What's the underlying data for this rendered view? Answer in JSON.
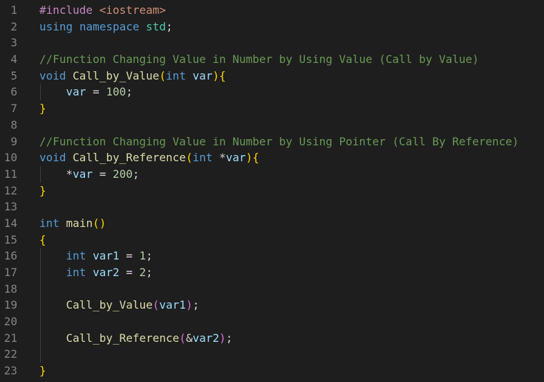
{
  "editor": {
    "theme_colors": {
      "background": "#1e1e1e",
      "line_number": "#858585",
      "preprocessor": "#c586c0",
      "string": "#ce9178",
      "keyword": "#569cd6",
      "namespace": "#4ec9b0",
      "comment": "#6a9955",
      "function": "#dcdcaa",
      "variable": "#9cdcfe",
      "number": "#b5cea8",
      "bracket_level_1": "#ffd700",
      "bracket_level_2": "#da70d6"
    },
    "lines": [
      {
        "n": "1",
        "tokens": [
          {
            "t": "#include ",
            "c": "pp"
          },
          {
            "t": "<iostream>",
            "c": "str"
          }
        ]
      },
      {
        "n": "2",
        "tokens": [
          {
            "t": "using",
            "c": "kw"
          },
          {
            "t": " ",
            "c": "op"
          },
          {
            "t": "namespace",
            "c": "kw"
          },
          {
            "t": " ",
            "c": "op"
          },
          {
            "t": "std",
            "c": "ns"
          },
          {
            "t": ";",
            "c": "op"
          }
        ]
      },
      {
        "n": "3",
        "tokens": []
      },
      {
        "n": "4",
        "tokens": [
          {
            "t": "//Function Changing Value in Number by Using Value (Call by Value)",
            "c": "cm"
          }
        ]
      },
      {
        "n": "5",
        "tokens": [
          {
            "t": "void",
            "c": "kw"
          },
          {
            "t": " ",
            "c": "op"
          },
          {
            "t": "Call_by_Value",
            "c": "fn"
          },
          {
            "t": "(",
            "c": "b1"
          },
          {
            "t": "int",
            "c": "kw"
          },
          {
            "t": " ",
            "c": "op"
          },
          {
            "t": "var",
            "c": "var"
          },
          {
            "t": ")",
            "c": "b1"
          },
          {
            "t": "{",
            "c": "b1"
          }
        ]
      },
      {
        "n": "6",
        "tokens": [
          {
            "t": "    ",
            "c": "op"
          },
          {
            "t": "var",
            "c": "var"
          },
          {
            "t": " = ",
            "c": "op"
          },
          {
            "t": "100",
            "c": "num"
          },
          {
            "t": ";",
            "c": "op"
          }
        ]
      },
      {
        "n": "7",
        "tokens": [
          {
            "t": "}",
            "c": "b1"
          }
        ]
      },
      {
        "n": "8",
        "tokens": []
      },
      {
        "n": "9",
        "tokens": [
          {
            "t": "//Function Changing Value in Number by Using Pointer (Call By Reference)",
            "c": "cm"
          }
        ]
      },
      {
        "n": "10",
        "tokens": [
          {
            "t": "void",
            "c": "kw"
          },
          {
            "t": " ",
            "c": "op"
          },
          {
            "t": "Call_by_Reference",
            "c": "fn"
          },
          {
            "t": "(",
            "c": "b1"
          },
          {
            "t": "int",
            "c": "kw"
          },
          {
            "t": " *",
            "c": "op"
          },
          {
            "t": "var",
            "c": "var"
          },
          {
            "t": ")",
            "c": "b1"
          },
          {
            "t": "{",
            "c": "b1"
          }
        ]
      },
      {
        "n": "11",
        "tokens": [
          {
            "t": "    *",
            "c": "op"
          },
          {
            "t": "var",
            "c": "var"
          },
          {
            "t": " = ",
            "c": "op"
          },
          {
            "t": "200",
            "c": "num"
          },
          {
            "t": ";",
            "c": "op"
          }
        ]
      },
      {
        "n": "12",
        "tokens": [
          {
            "t": "}",
            "c": "b1"
          }
        ]
      },
      {
        "n": "13",
        "tokens": []
      },
      {
        "n": "14",
        "tokens": [
          {
            "t": "int",
            "c": "kw"
          },
          {
            "t": " ",
            "c": "op"
          },
          {
            "t": "main",
            "c": "fn"
          },
          {
            "t": "()",
            "c": "b1"
          }
        ]
      },
      {
        "n": "15",
        "tokens": [
          {
            "t": "{",
            "c": "b1"
          }
        ]
      },
      {
        "n": "16",
        "tokens": [
          {
            "t": "    ",
            "c": "op"
          },
          {
            "t": "int",
            "c": "kw"
          },
          {
            "t": " ",
            "c": "op"
          },
          {
            "t": "var1",
            "c": "var"
          },
          {
            "t": " = ",
            "c": "op"
          },
          {
            "t": "1",
            "c": "num"
          },
          {
            "t": ";",
            "c": "op"
          }
        ]
      },
      {
        "n": "17",
        "tokens": [
          {
            "t": "    ",
            "c": "op"
          },
          {
            "t": "int",
            "c": "kw"
          },
          {
            "t": " ",
            "c": "op"
          },
          {
            "t": "var2",
            "c": "var"
          },
          {
            "t": " = ",
            "c": "op"
          },
          {
            "t": "2",
            "c": "num"
          },
          {
            "t": ";",
            "c": "op"
          }
        ]
      },
      {
        "n": "18",
        "tokens": []
      },
      {
        "n": "19",
        "tokens": [
          {
            "t": "    ",
            "c": "op"
          },
          {
            "t": "Call_by_Value",
            "c": "fn"
          },
          {
            "t": "(",
            "c": "b2"
          },
          {
            "t": "var1",
            "c": "var"
          },
          {
            "t": ")",
            "c": "b2"
          },
          {
            "t": ";",
            "c": "op"
          }
        ]
      },
      {
        "n": "20",
        "tokens": []
      },
      {
        "n": "21",
        "tokens": [
          {
            "t": "    ",
            "c": "op"
          },
          {
            "t": "Call_by_Reference",
            "c": "fn"
          },
          {
            "t": "(",
            "c": "b2"
          },
          {
            "t": "&",
            "c": "op"
          },
          {
            "t": "var2",
            "c": "var"
          },
          {
            "t": ")",
            "c": "b2"
          },
          {
            "t": ";",
            "c": "op"
          }
        ]
      },
      {
        "n": "22",
        "tokens": []
      },
      {
        "n": "23",
        "tokens": [
          {
            "t": "}",
            "c": "b1"
          }
        ]
      }
    ]
  }
}
